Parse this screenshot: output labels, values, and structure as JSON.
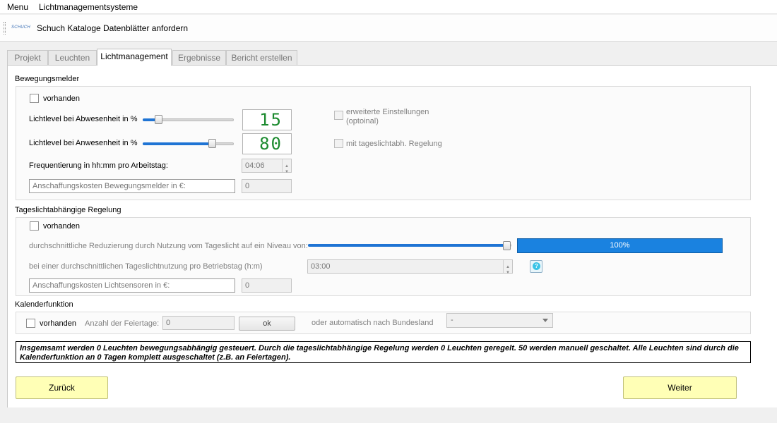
{
  "menubar": {
    "menu": "Menu",
    "title": "Lichtmanagementsysteme"
  },
  "toolbar": {
    "logo_text": "SCHUCH",
    "catalog": "Schuch Kataloge",
    "datasheets": "Datenblätter anfordern"
  },
  "tabs": [
    {
      "label": "Projekt"
    },
    {
      "label": "Leuchten"
    },
    {
      "label": "Lichtmanagement"
    },
    {
      "label": "Ergebnisse"
    },
    {
      "label": "Bericht erstellen"
    }
  ],
  "motion": {
    "section": "Bewegungsmelder",
    "present_label": "vorhanden",
    "absent_level_label": "Lichtlevel bei Abwesenheit in %",
    "absent_level_value": "15",
    "present_level_label": "Lichtlevel bei Anwesenheit in %",
    "present_level_value": "80",
    "frequency_label": "Frequentierung in hh:mm pro Arbeitstag:",
    "frequency_value": "04:06",
    "cost_placeholder": "Anschaffungskosten Bewegungsmelder in €:",
    "cost_value": "0",
    "extended_settings_line1": "erweiterte Einstellungen",
    "extended_settings_line2": "(optoinal)",
    "daylight_regulation": "mit tageslichtabh. Regelung"
  },
  "daylight": {
    "section": "Tageslichtabhängige Regelung",
    "present_label": "vorhanden",
    "reduction_label": "durchschnittliche Reduzierung durch Nutzung vom Tageslicht auf ein Niveau von:",
    "reduction_percent": "100%",
    "usage_label": "bei einer durchschnittlichen Tageslichtnutzung pro Betriebstag (h:m)",
    "usage_value": "03:00",
    "help": "?",
    "cost_placeholder": "Anschaffungskosten Lichtsensoren in €:",
    "cost_value": "0"
  },
  "calendar": {
    "section": "Kalenderfunktion",
    "present_label": "vorhanden",
    "holidays_label": "Anzahl der Feiertage:",
    "holidays_value": "0",
    "ok_button": "ok",
    "auto_label": "oder automatisch nach Bundesland",
    "state_value": "-"
  },
  "summary": "Insgemsamt werden 0 Leuchten bewegungsabhängig gesteuert. Durch die tageslichtabhängige Regelung werden 0 Leuchten geregelt. 50 werden manuell geschaltet. Alle Leuchten sind durch die Kalenderfunktion an 0 Tagen komplett ausgeschaltet (z.B. an Feiertagen).",
  "buttons": {
    "back": "Zurück",
    "next": "Weiter"
  },
  "colors": {
    "accent": "#1f74d4",
    "lcd_green": "#1b8a2e",
    "nav_button": "#ffffb6"
  }
}
